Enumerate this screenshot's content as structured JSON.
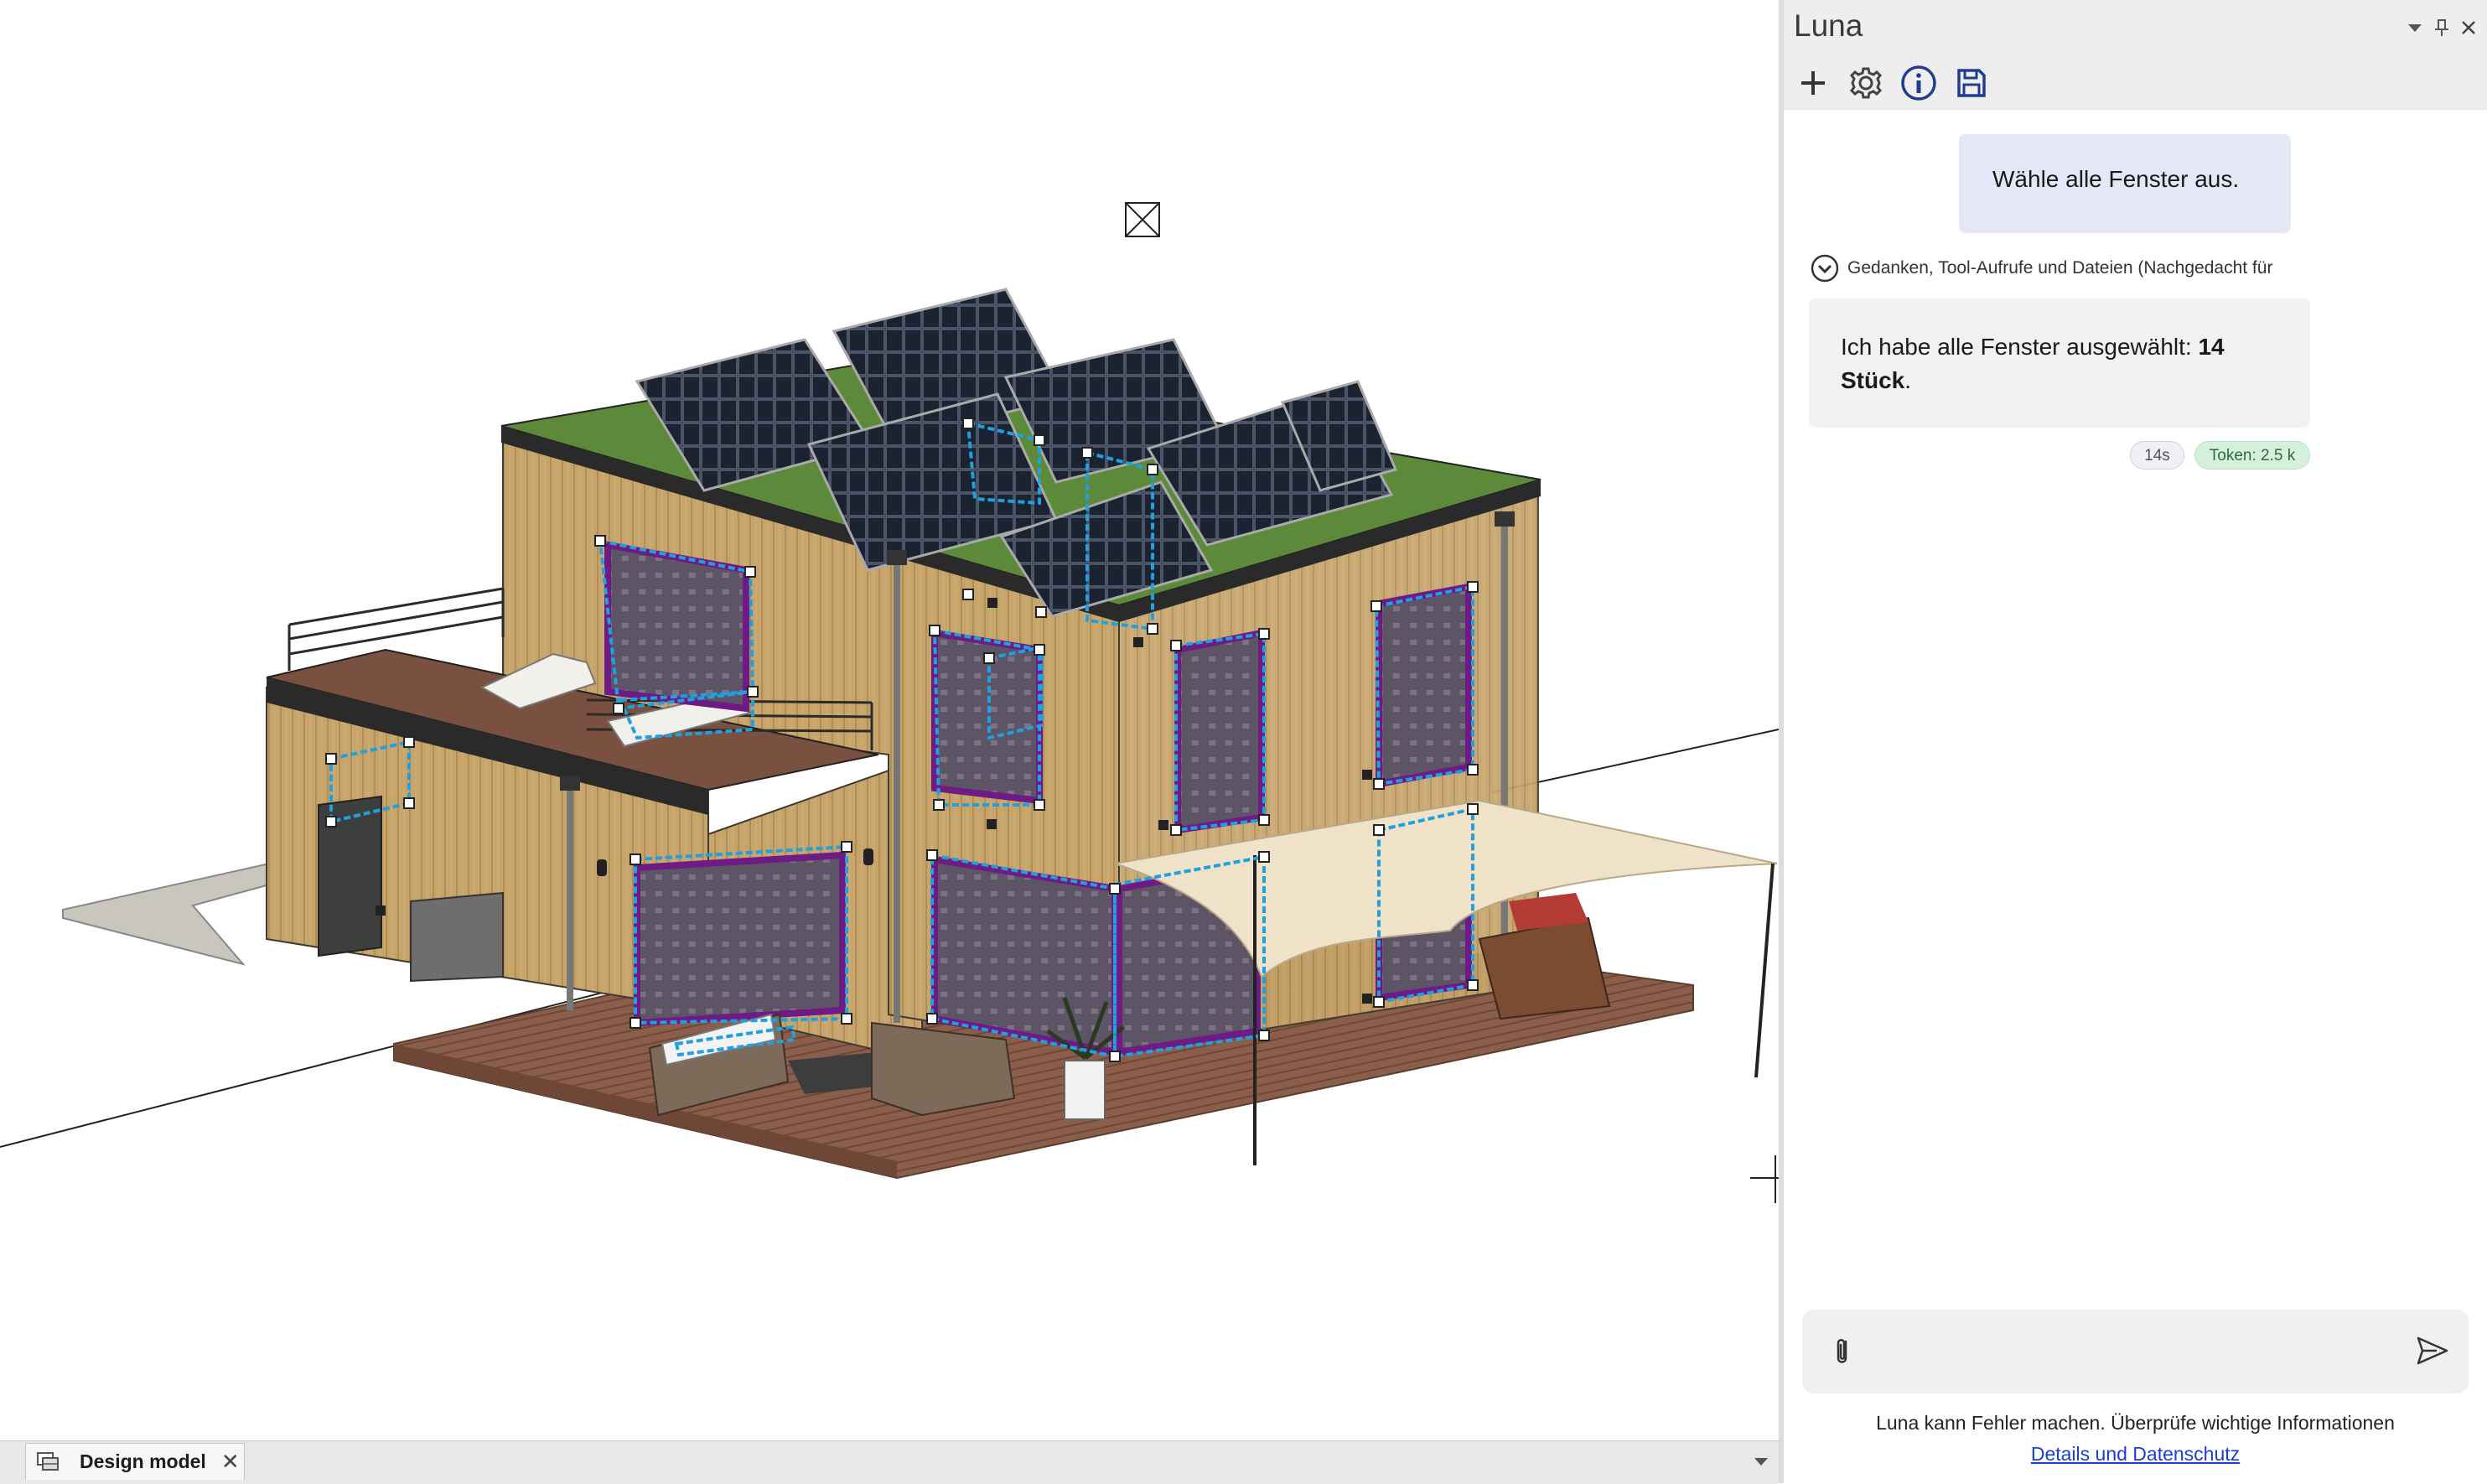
{
  "panel": {
    "title": "Luna",
    "header_buttons": [
      "dropdown-icon",
      "pin-icon",
      "close-icon"
    ],
    "toolbar_icons": [
      "plus-icon",
      "gear-icon",
      "info-icon",
      "save-icon"
    ]
  },
  "chat": {
    "user_message": "Wähle alle Fenster aus.",
    "thoughts_label": "Gedanken, Tool-Aufrufe und Dateien (Nachgedacht für",
    "assistant_text_before": "Ich habe alle Fenster ausgewählt: ",
    "assistant_bold": "14 Stück",
    "assistant_text_after": ".",
    "badge_time": "14s",
    "badge_token": "Token: 2.5 k"
  },
  "input": {
    "placeholder": "",
    "value": ""
  },
  "footer": {
    "disclaimer": "Luna kann Fehler machen. Überprüfe wichtige Informationen",
    "link": "Details und Datenschutz"
  },
  "tabs": [
    {
      "label": "Design model",
      "active": true
    }
  ],
  "colors": {
    "selection": "#1fa0e0",
    "user_bubble": "#e4e7f6",
    "assistant_bubble": "#f1f1f1",
    "token_badge": "#d5f1dc",
    "link": "#1a3fd0",
    "window_frame": "#7a1a8f",
    "wood": "#c9a66b",
    "solar": "#1c2433",
    "roof_green": "#5f8a3c"
  }
}
